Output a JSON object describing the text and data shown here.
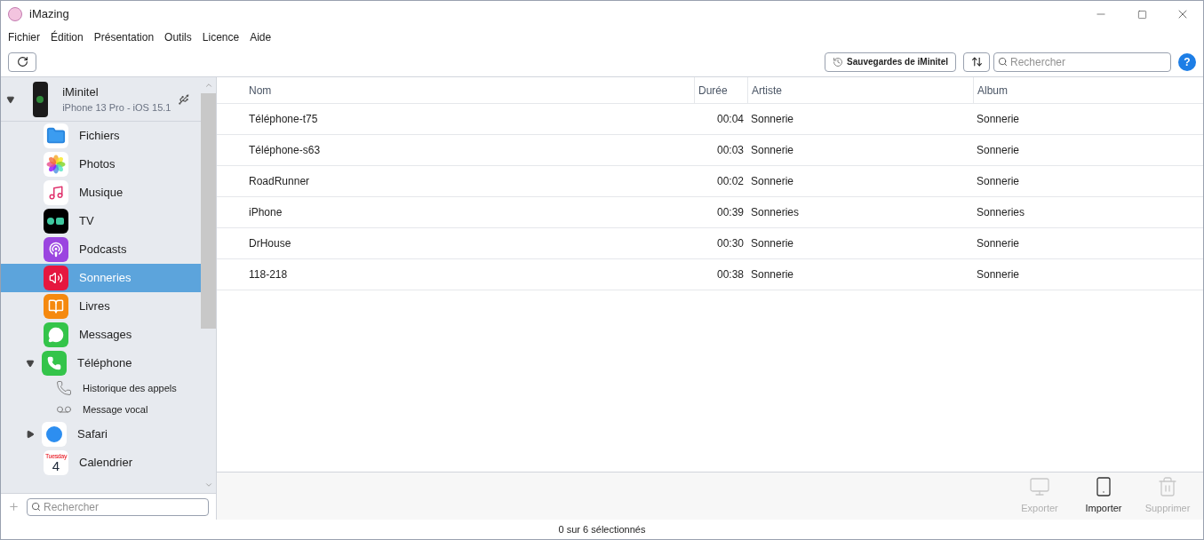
{
  "window": {
    "title": "iMazing"
  },
  "menu": [
    "Fichier",
    "Édition",
    "Présentation",
    "Outils",
    "Licence",
    "Aide"
  ],
  "toolbar": {
    "backups_button": "Sauvegardes de iMinitel",
    "search": {
      "placeholder": "Rechercher"
    },
    "help": "?"
  },
  "device": {
    "name": "iMinitel",
    "model": "iPhone 13 Pro - iOS 15.1",
    "expanded": true
  },
  "sidebar": {
    "items": [
      {
        "label": "Fichiers",
        "selected": false
      },
      {
        "label": "Photos",
        "selected": false
      },
      {
        "label": "Musique",
        "selected": false
      },
      {
        "label": "TV",
        "selected": false
      },
      {
        "label": "Podcasts",
        "selected": false
      },
      {
        "label": "Sonneries",
        "selected": true
      },
      {
        "label": "Livres",
        "selected": false
      },
      {
        "label": "Messages",
        "selected": false
      },
      {
        "label": "Téléphone",
        "selected": false,
        "expanded": true,
        "children": [
          {
            "label": "Historique des appels",
            "selected": false
          },
          {
            "label": "Message vocal",
            "selected": false
          }
        ]
      },
      {
        "label": "Safari",
        "selected": false,
        "expanded": false
      },
      {
        "label": "Calendrier",
        "selected": false,
        "icon_text": [
          "Tuesday",
          "4"
        ]
      }
    ],
    "search": {
      "placeholder": "Rechercher"
    }
  },
  "table": {
    "columns": [
      "Nom",
      "Durée",
      "Artiste",
      "Album"
    ],
    "rows": [
      [
        "Téléphone-t75",
        "00:04",
        "Sonnerie",
        "Sonnerie"
      ],
      [
        "Téléphone-s63",
        "00:03",
        "Sonnerie",
        "Sonnerie"
      ],
      [
        "RoadRunner",
        "00:02",
        "Sonnerie",
        "Sonnerie"
      ],
      [
        "iPhone",
        "00:39",
        "Sonneries",
        "Sonneries"
      ],
      [
        "DrHouse",
        "00:30",
        "Sonnerie",
        "Sonnerie"
      ],
      [
        "118-218",
        "00:38",
        "Sonnerie",
        "Sonnerie"
      ]
    ]
  },
  "actions": [
    {
      "label": "Exporter",
      "disabled": true
    },
    {
      "label": "Importer",
      "disabled": false
    },
    {
      "label": "Supprimer",
      "disabled": true
    }
  ],
  "status_bar": "0 sur 6 sélectionnés"
}
